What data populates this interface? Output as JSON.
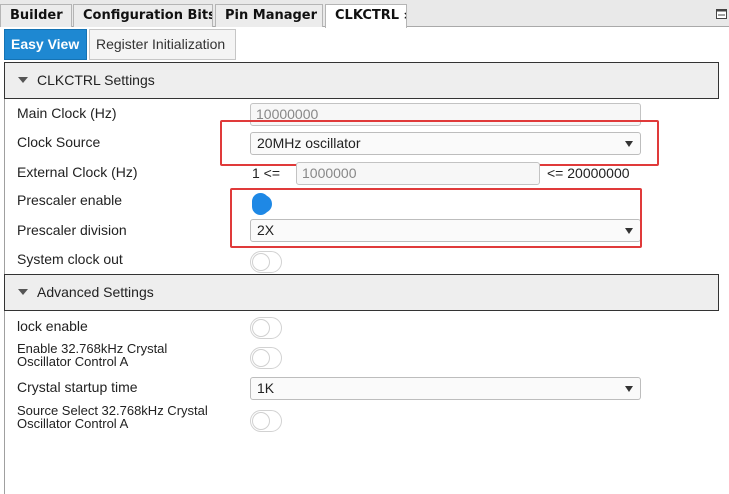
{
  "tabs": [
    {
      "label": "Builder"
    },
    {
      "label": "Configuration Bits"
    },
    {
      "label": "Pin Manager"
    },
    {
      "label": "CLKCTRL",
      "close": "×",
      "active": true
    }
  ],
  "subtabs": {
    "easy_view": "Easy View",
    "register_init": "Register Initialization"
  },
  "clkctrl_section": {
    "title": "CLKCTRL Settings",
    "main_clock": {
      "label": "Main Clock (Hz)",
      "value": "10000000"
    },
    "clock_source": {
      "label": "Clock Source",
      "value": "20MHz oscillator"
    },
    "external_clock": {
      "label": "External Clock (Hz)",
      "min": "1 <=",
      "value": "1000000",
      "max": "<= 20000000"
    },
    "prescaler_enable": {
      "label": "Prescaler enable",
      "on": true
    },
    "prescaler_division": {
      "label": "Prescaler division",
      "value": "2X"
    },
    "system_clock_out": {
      "label": "System clock out",
      "on": false
    }
  },
  "advanced_section": {
    "title": "Advanced Settings",
    "lock_enable": {
      "label": "lock enable",
      "on": false
    },
    "enable_xosc": {
      "label_line1": "Enable 32.768kHz Crystal",
      "label_line2": "Oscillator Control A",
      "on": false
    },
    "crystal_startup": {
      "label": "Crystal startup time",
      "value": "1K"
    },
    "source_select": {
      "label_line1": "Source Select 32.768kHz Crystal",
      "label_line2": "Oscillator Control A",
      "on": false
    }
  },
  "colors": {
    "accent": "#1e88d2",
    "highlight": "#e03a3a"
  }
}
